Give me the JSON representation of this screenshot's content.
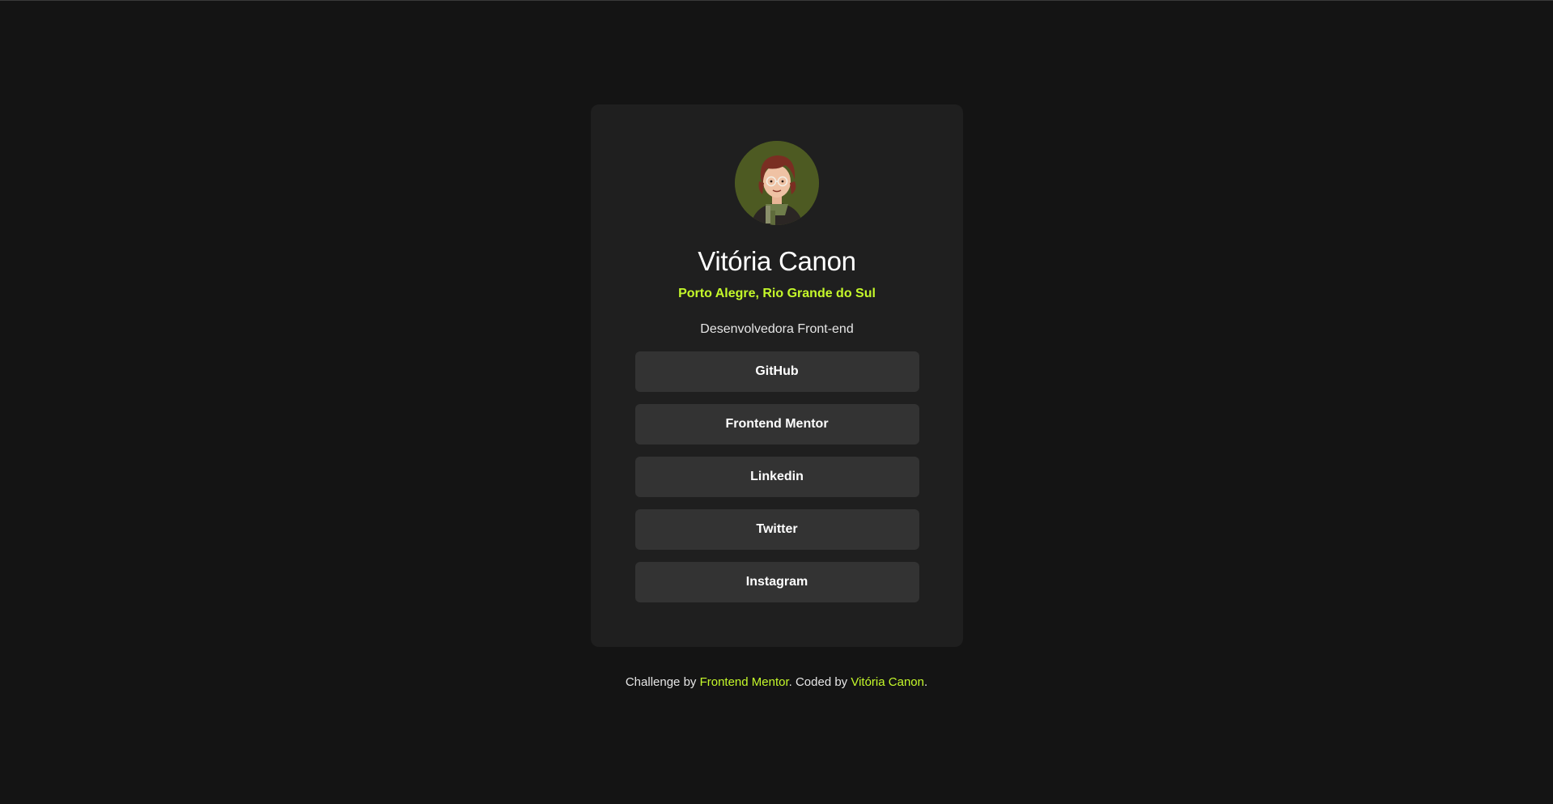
{
  "profile": {
    "avatar_icon": "person-avatar-illustration",
    "name": "Vitória Canon",
    "location": "Porto Alegre, Rio Grande do Sul",
    "bio": "Desenvolvedora Front-end"
  },
  "links": [
    {
      "label": "GitHub"
    },
    {
      "label": "Frontend Mentor"
    },
    {
      "label": "Linkedin"
    },
    {
      "label": "Twitter"
    },
    {
      "label": "Instagram"
    }
  ],
  "footer": {
    "prefix": "Challenge by ",
    "challenge_link": "Frontend Mentor",
    "middle": ". Coded by ",
    "author_link": "Vitória Canon",
    "suffix": "."
  },
  "colors": {
    "background": "#141414",
    "card": "#1f1f1f",
    "button": "#333333",
    "accent": "#c4f82a",
    "text": "#ffffff"
  }
}
